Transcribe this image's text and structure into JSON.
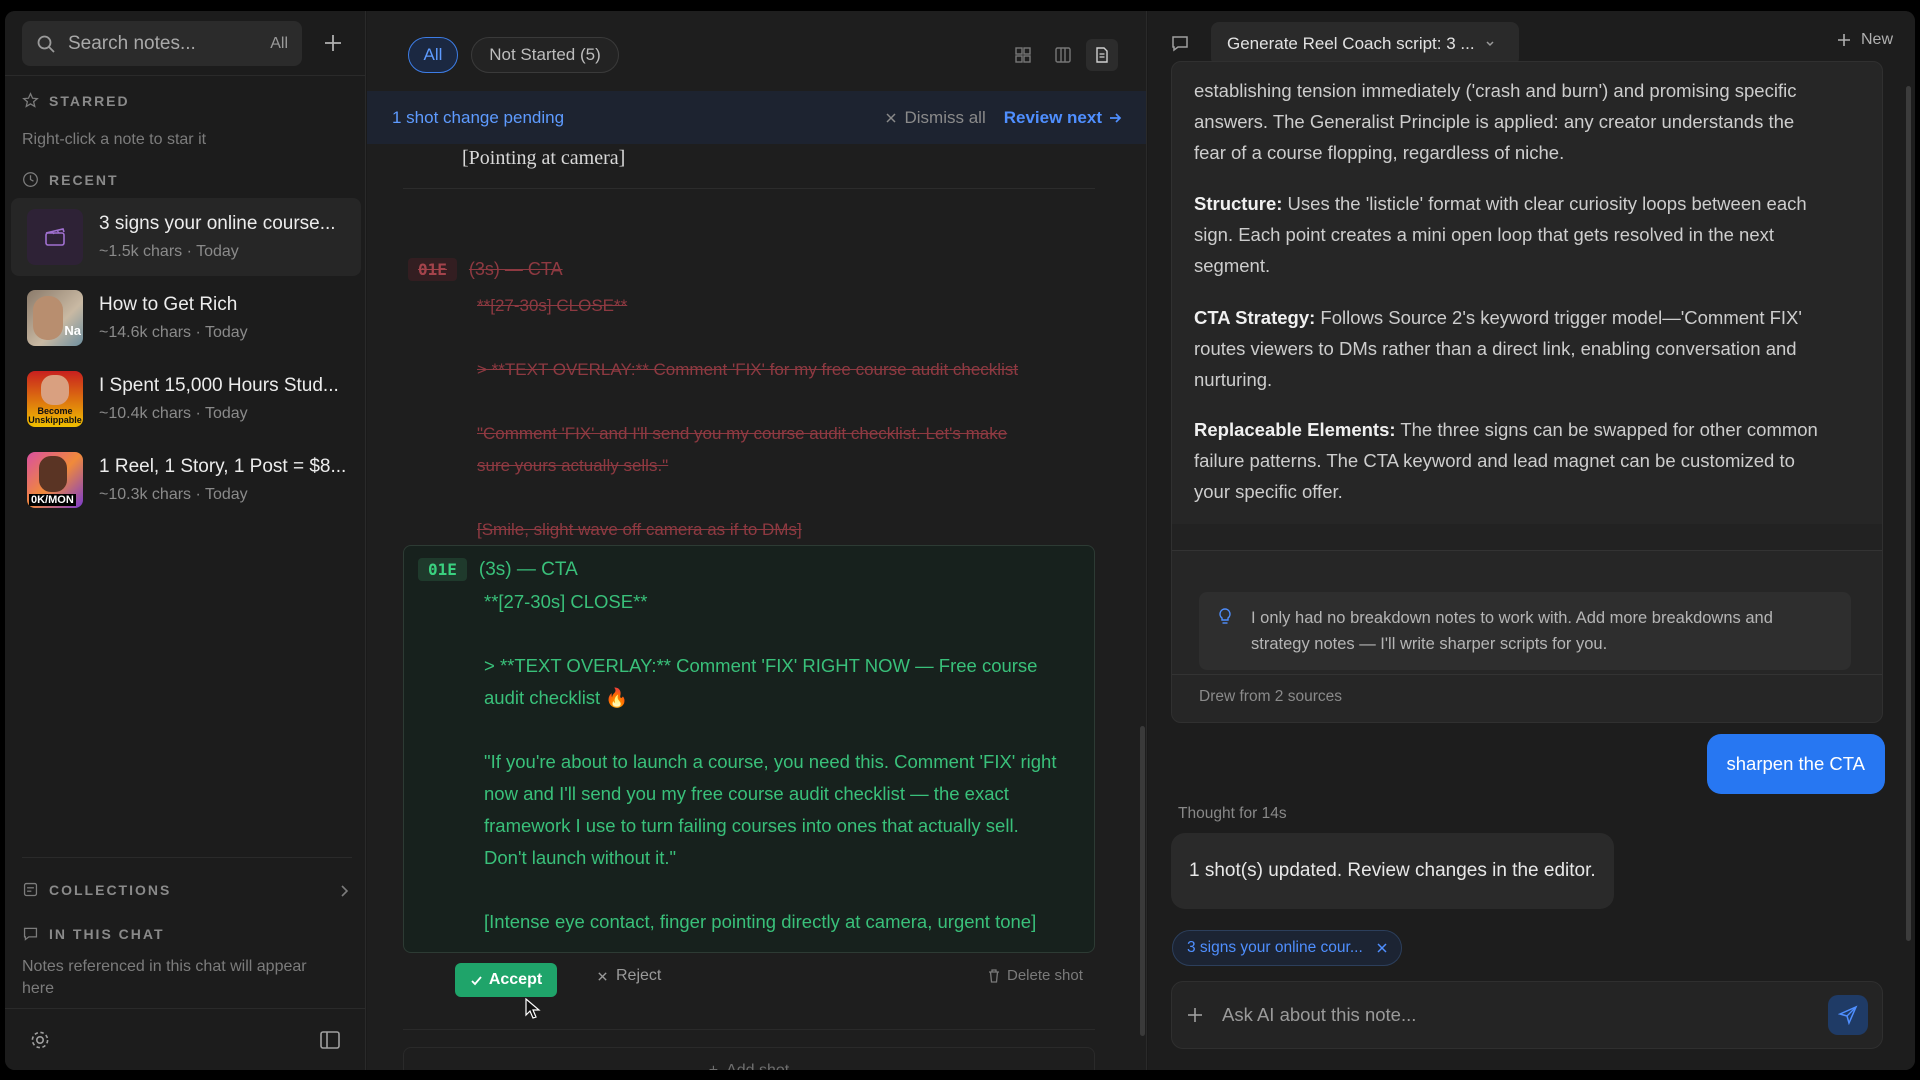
{
  "sidebar": {
    "search_placeholder": "Search notes...",
    "search_scope": "All",
    "starred_label": "STARRED",
    "starred_hint": "Right-click a note to star it",
    "recent_label": "RECENT",
    "notes": [
      {
        "title": "3 signs your online course...",
        "meta": "~1.5k chars · Today"
      },
      {
        "title": "How to Get Rich",
        "meta": "~14.6k chars · Today"
      },
      {
        "title": "I Spent 15,000 Hours Stud...",
        "meta": "~10.4k chars · Today"
      },
      {
        "title": "1 Reel, 1 Story, 1 Post = $8...",
        "meta": "~10.3k chars · Today"
      }
    ],
    "thumb_texts": {
      "rich": "Na",
      "become": "Become\nUnskippable",
      "mon": "0K/MON"
    },
    "collections_label": "COLLECTIONS",
    "in_chat_label": "IN THIS CHAT",
    "in_chat_hint": "Notes referenced in this chat will appear here"
  },
  "editor": {
    "filter_all": "All",
    "filter_not_started": "Not Started (5)",
    "banner_pending": "1 shot change pending",
    "banner_dismiss": "Dismiss all",
    "banner_review": "Review next",
    "prev_line": "[Pointing at camera]",
    "old_shot": {
      "id": "01E",
      "timing": "(3s) — CTA",
      "close": "**[27-30s] CLOSE**",
      "overlay": "> **TEXT OVERLAY:** Comment 'FIX' for my free course audit checklist",
      "quote_1": "\"Comment 'FIX' and I'll send you my course audit checklist. Let's make",
      "quote_2": "sure yours actually sells.\"",
      "direction": "[Smile, slight wave off camera as if to DMs]"
    },
    "new_shot": {
      "id": "01E",
      "timing": "(3s) — CTA",
      "close": "**[27-30s] CLOSE**",
      "overlay_1": "> **TEXT OVERLAY:** Comment 'FIX' RIGHT NOW — Free course",
      "overlay_2": "audit checklist 🔥",
      "quote_1": "\"If you're about to launch a course, you need this. Comment 'FIX' right",
      "quote_2": "now and I'll send you my free course audit checklist — the exact",
      "quote_3": "framework I use to turn failing courses into ones that actually sell.",
      "quote_4": "Don't launch without it.\"",
      "direction": "[Intense eye contact, finger pointing directly at camera, urgent tone]"
    },
    "accept_label": "Accept",
    "reject_label": "Reject",
    "delete_label": "Delete shot",
    "add_shot_label": "Add shot"
  },
  "chat": {
    "conversation_title": "Generate Reel Coach script: 3 ...",
    "new_label": "New",
    "plan_intro_1": "establishing tension immediately ('crash and burn') and promising specific",
    "plan_intro_2": "answers. The Generalist Principle is applied: any creator understands the",
    "plan_intro_3": "fear of a course flopping, regardless of niche.",
    "structure_label": "Structure:",
    "structure_1": " Uses the 'listicle' format with clear curiosity loops between each",
    "structure_2": "sign. Each point creates a mini open loop that gets resolved in the next",
    "structure_3": "segment.",
    "cta_label": "CTA Strategy:",
    "cta_1": " Follows Source 2's keyword trigger model—'Comment FIX'",
    "cta_2": "routes viewers to DMs rather than a direct link, enabling conversation and",
    "cta_3": "nurturing.",
    "repl_label": "Replaceable Elements:",
    "repl_1": " The three signs can be swapped for other common",
    "repl_2": "failure patterns. The CTA keyword and lead magnet can be customized to",
    "repl_3": "your specific offer.",
    "tip_1": "I only had no breakdown notes to work with. Add more breakdowns and",
    "tip_2": "strategy notes — I'll write sharper scripts for you.",
    "drew_from": "Drew from 2 sources",
    "user_message": "sharpen the CTA",
    "thought": "Thought for 14s",
    "ai_message": "1 shot(s) updated. Review changes in the editor.",
    "chip_label": "3 signs your online cour...",
    "composer_placeholder": "Ask AI about this note..."
  },
  "colors": {
    "accent_blue": "#2777f2",
    "accept_green": "#1fa46a",
    "diff_red": "#b4434d",
    "diff_green": "#39c07a"
  }
}
